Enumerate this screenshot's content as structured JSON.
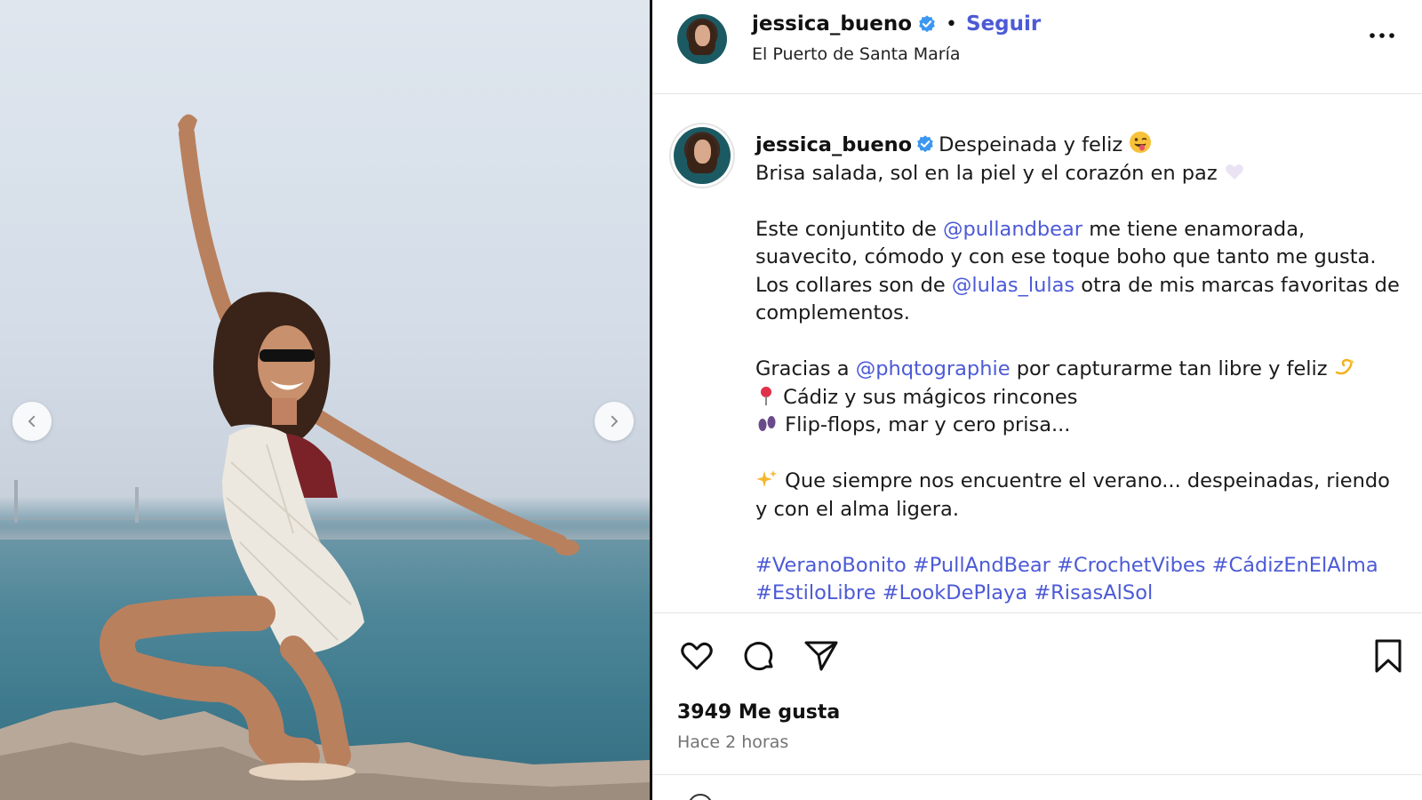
{
  "post": {
    "username": "jessica_bueno",
    "follow_label": "Seguir",
    "separator": "•",
    "location": "El Puerto de Santa María"
  },
  "caption": {
    "username": "jessica_bueno",
    "title": "Despeinada y feliz",
    "line1": "Brisa salada, sol en la piel y el corazón en paz",
    "p2_a": "Este conjuntito de ",
    "mention1": "@pullandbear",
    "p2_b": " me tiene enamorada, suavecito, cómodo y con ese toque boho que tanto me gusta.",
    "p3_a": "Los collares son de ",
    "mention2": "@lulas_lulas",
    "p3_b": " otra de mis marcas favoritas de complementos.",
    "p4_a": "Gracias a ",
    "mention3": "@phqtographie",
    "p4_b": " por capturarme tan libre y feliz",
    "line_cadiz": "Cádiz y sus mágicos rincones",
    "line_flipflops": "Flip-flops, mar y cero prisa...",
    "p5": "Que siempre nos encuentre el verano... despeinadas, riendo y con el alma ligera.",
    "hashtags": [
      "#VeranoBonito",
      "#PullAndBear",
      "#CrochetVibes",
      "#CádizEnElAlma",
      "#EstiloLibre",
      "#LookDePlaya",
      "#RisasAlSol"
    ]
  },
  "stats": {
    "likes": "3949 Me gusta",
    "time": "Hace 2 horas"
  },
  "icons": {
    "verified": "verified-badge-icon",
    "more": "more-options-icon",
    "like": "heart-icon",
    "comment": "comment-icon",
    "share": "send-icon",
    "save": "bookmark-icon",
    "prev": "chevron-left-icon",
    "next": "chevron-right-icon"
  },
  "colors": {
    "link": "#4c5ad6",
    "verified": "#3b97f0",
    "muted": "#737373"
  }
}
